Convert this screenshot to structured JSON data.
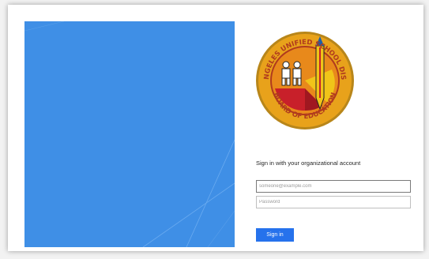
{
  "logo": {
    "org_name_top": "LOS ANGELES UNIFIED SCHOOL DISTRICT",
    "org_name_bottom": "BOARD OF EDUCATION"
  },
  "login": {
    "heading": "Sign in with your organizational account",
    "username_placeholder": "someone@example.com",
    "password_placeholder": "Password",
    "submit_label": "Sign in"
  },
  "colors": {
    "illustration_blue": "#3f8fe6",
    "button_blue": "#2672ec",
    "seal_gold": "#e8a21b",
    "seal_red": "#c8202a",
    "seal_blue": "#1d5fa8"
  }
}
